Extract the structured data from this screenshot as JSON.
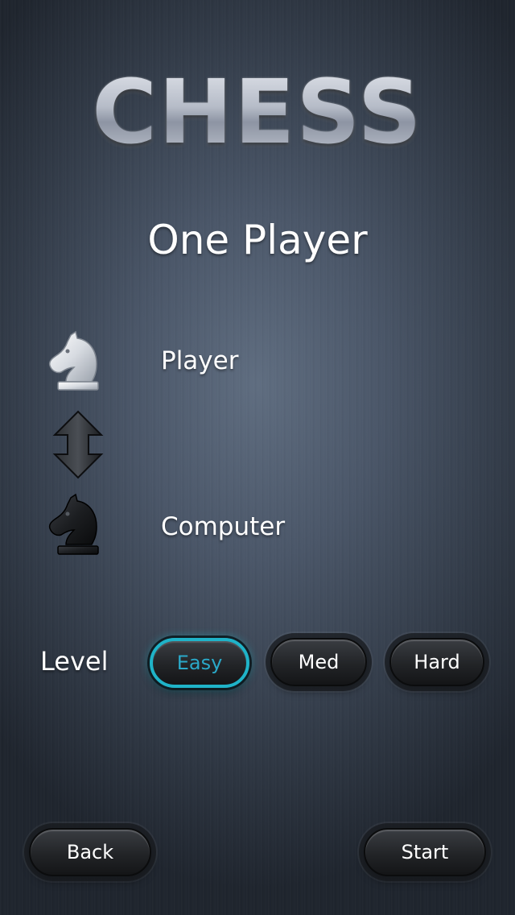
{
  "app": {
    "title": "CHESS",
    "mode_title": "One Player"
  },
  "players": {
    "top": {
      "label": "Player",
      "icon": "white-knight-icon"
    },
    "swap_icon": "swap-arrows-icon",
    "bottom": {
      "label": "Computer",
      "icon": "black-knight-icon"
    }
  },
  "level": {
    "label": "Level",
    "options": [
      "Easy",
      "Med",
      "Hard"
    ],
    "selected": "Easy"
  },
  "footer": {
    "back_label": "Back",
    "start_label": "Start"
  },
  "colors": {
    "accent": "#1fb3c8",
    "text": "#ffffff"
  }
}
